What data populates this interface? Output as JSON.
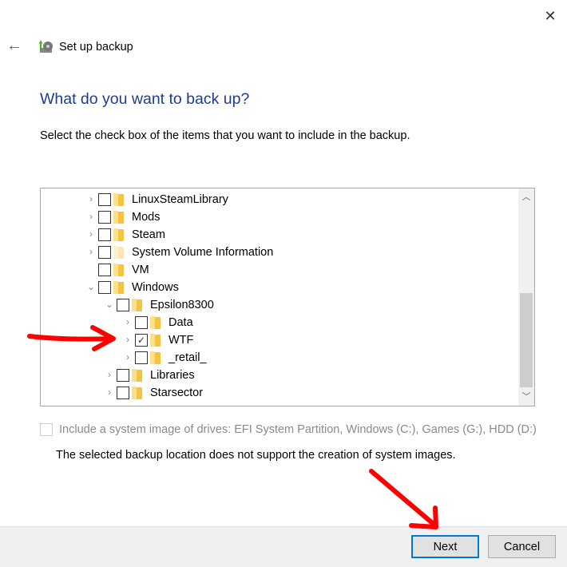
{
  "window": {
    "title": "Set up backup",
    "close_icon": "close-icon",
    "back_icon": "back-arrow-icon"
  },
  "page": {
    "heading": "What do you want to back up?",
    "instruction": "Select the check box of the items that you want to include in the backup."
  },
  "tree": {
    "items": [
      {
        "label": "LinuxSteamLibrary",
        "level": 0,
        "expander": "collapsed",
        "checked": false
      },
      {
        "label": "Mods",
        "level": 0,
        "expander": "collapsed",
        "checked": false
      },
      {
        "label": "Steam",
        "level": 0,
        "expander": "collapsed",
        "checked": false
      },
      {
        "label": "System Volume Information",
        "level": 0,
        "expander": "collapsed",
        "checked": false,
        "hidden_folder": true
      },
      {
        "label": "VM",
        "level": 0,
        "expander": "none",
        "checked": false
      },
      {
        "label": "Windows",
        "level": 0,
        "expander": "expanded",
        "checked": false
      },
      {
        "label": "Epsilon8300",
        "level": 1,
        "expander": "expanded",
        "checked": false
      },
      {
        "label": "Data",
        "level": 2,
        "expander": "collapsed",
        "checked": false
      },
      {
        "label": "WTF",
        "level": 2,
        "expander": "collapsed",
        "checked": true
      },
      {
        "label": "_retail_",
        "level": 2,
        "expander": "collapsed",
        "checked": false
      },
      {
        "label": "Libraries",
        "level": 1,
        "expander": "collapsed",
        "checked": false
      },
      {
        "label": "Starsector",
        "level": 1,
        "expander": "collapsed",
        "checked": false
      }
    ]
  },
  "system_image": {
    "label": "Include a system image of drives: EFI System Partition, Windows (C:), Games (G:), HDD (D:)",
    "checked": false,
    "enabled": false
  },
  "notice": "The selected backup location does not support the creation of system images.",
  "buttons": {
    "next": "Next",
    "cancel": "Cancel"
  },
  "colors": {
    "heading": "#1f3c93",
    "annotation_arrow": "#ff0000",
    "focus_border": "#0078d7"
  }
}
